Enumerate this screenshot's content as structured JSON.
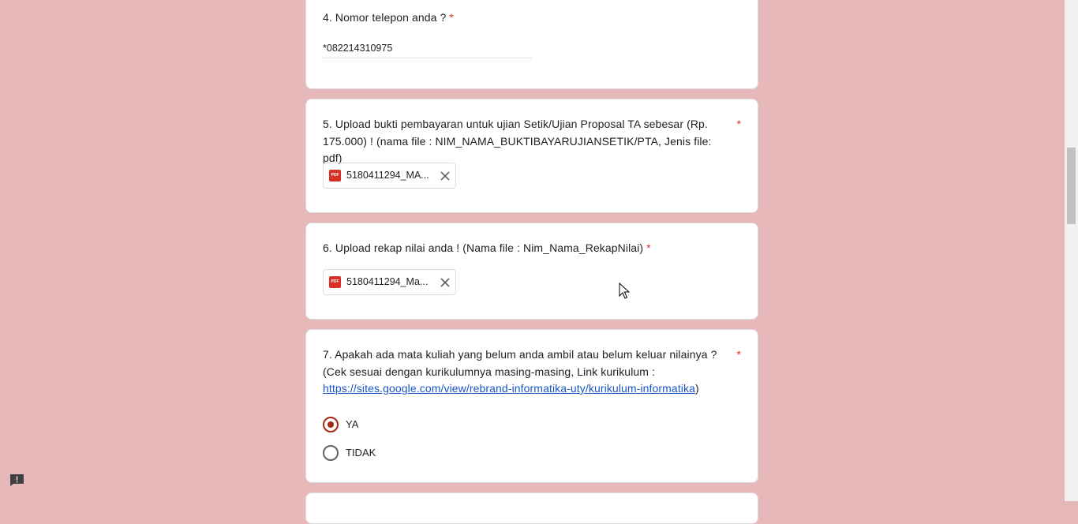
{
  "questions": {
    "q4": {
      "title": "4. Nomor telepon anda ?",
      "required": "*",
      "answer": "*082214310975"
    },
    "q5": {
      "title": "5. Upload bukti pembayaran untuk ujian Setik/Ujian Proposal TA sebesar (Rp. 175.000) ! (nama file : NIM_NAMA_BUKTIBAYARUJIANSETIK/PTA, Jenis file: pdf)",
      "required": "*",
      "file": {
        "name": "5180411294_MA...",
        "icon": "pdf-icon",
        "icon_text": "PDF"
      }
    },
    "q6": {
      "title": "6. Upload rekap nilai anda ! (Nama file : Nim_Nama_RekapNilai)",
      "required": "*",
      "file": {
        "name": "5180411294_Ma...",
        "icon": "pdf-icon",
        "icon_text": "PDF"
      }
    },
    "q7": {
      "title_before": "7. Apakah ada mata kuliah yang belum anda ambil atau belum keluar nilainya ? (Cek sesuai dengan kurikulumnya masing-masing, Link kurikulum :",
      "link": "https://sites.google.com/view/rebrand-informatika-uty/kurikulum-informatika",
      "title_after": ")",
      "required": "*",
      "options": [
        {
          "label": "YA",
          "selected": true
        },
        {
          "label": "TIDAK",
          "selected": false
        }
      ]
    }
  },
  "colors": {
    "background": "#e6b8b9",
    "required": "#d93025",
    "radio_accent": "#a52714",
    "link": "#1a55c6"
  },
  "icons": [
    "pdf-icon",
    "close-icon",
    "feedback-icon",
    "mouse-cursor"
  ]
}
